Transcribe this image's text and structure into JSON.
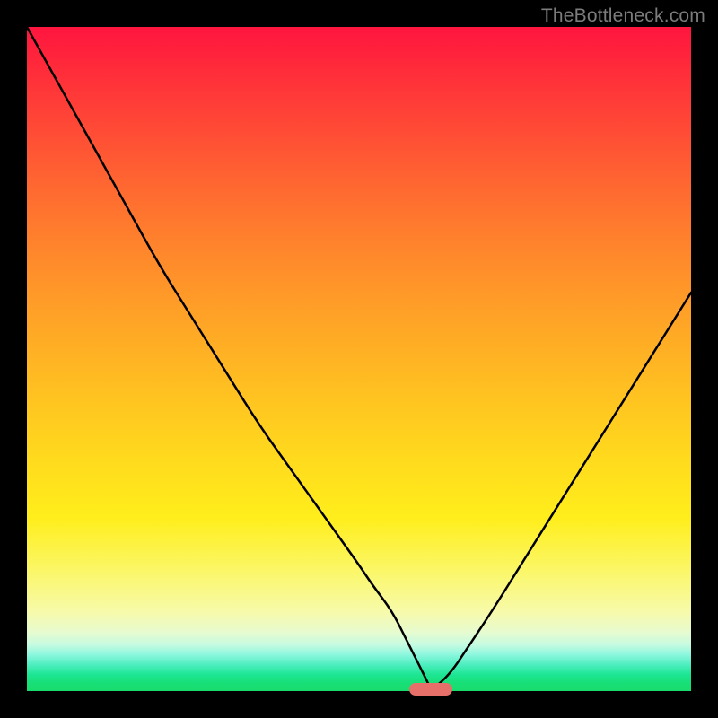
{
  "watermark": "TheBottleneck.com",
  "colors": {
    "frame": "#000000",
    "curve_stroke": "#000000",
    "marker_fill": "#e76f6a",
    "gradient_top": "#ff153f",
    "gradient_bottom": "#19dc6c"
  },
  "chart_data": {
    "type": "line",
    "title": "",
    "xlabel": "",
    "ylabel": "",
    "xlim": [
      0,
      100
    ],
    "ylim": [
      0,
      100
    ],
    "legend": false,
    "grid": false,
    "x": [
      0,
      5,
      10,
      15,
      20,
      25,
      30,
      35,
      40,
      45,
      50,
      52,
      55,
      57,
      58,
      59,
      60,
      60.8,
      62,
      64,
      66,
      70,
      75,
      80,
      85,
      90,
      95,
      100
    ],
    "y": [
      100,
      91,
      82,
      73,
      64,
      56,
      48,
      40,
      33,
      26,
      19,
      16,
      12,
      8,
      6,
      4,
      2,
      0.3,
      1,
      3,
      6,
      12,
      20,
      28,
      36,
      44,
      52,
      60
    ],
    "marker": {
      "x": 60.8,
      "y": 0.3
    },
    "annotations": []
  }
}
